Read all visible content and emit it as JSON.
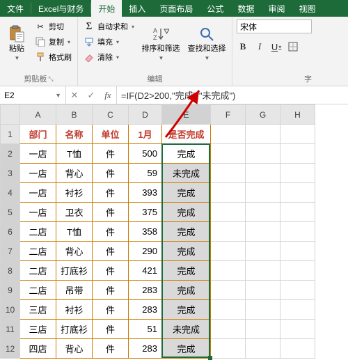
{
  "menu": {
    "file": "文件",
    "excel_finance": "Excel与财务",
    "start": "开始",
    "insert": "插入",
    "pagelayout": "页面布局",
    "formulas": "公式",
    "data": "数据",
    "review": "审阅",
    "view": "视图"
  },
  "ribbon": {
    "clipboard": {
      "label": "剪贴板",
      "paste": "粘贴",
      "cut": "剪切",
      "copy": "复制",
      "formatpainter": "格式刷"
    },
    "edit": {
      "label": "编辑",
      "autosum": "自动求和",
      "fill": "填充",
      "clear": "清除",
      "sortfilter": "排序和筛选",
      "findselect": "查找和选择"
    },
    "font": {
      "label_partial": "字",
      "family": "宋体"
    }
  },
  "formula_bar": {
    "cell_ref": "E2",
    "fx": "fx",
    "formula": "=IF(D2>200,\"完成\",\"未完成\")"
  },
  "chart_data": {
    "type": "table",
    "headers": {
      "dept": "部门",
      "name": "名称",
      "unit": "单位",
      "month": "1月",
      "status": "是否完成"
    },
    "rows": [
      {
        "dept": "一店",
        "name": "T恤",
        "unit": "件",
        "val": 500,
        "status": "完成"
      },
      {
        "dept": "一店",
        "name": "背心",
        "unit": "件",
        "val": 59,
        "status": "未完成"
      },
      {
        "dept": "一店",
        "name": "衬衫",
        "unit": "件",
        "val": 393,
        "status": "完成"
      },
      {
        "dept": "一店",
        "name": "卫衣",
        "unit": "件",
        "val": 375,
        "status": "完成"
      },
      {
        "dept": "二店",
        "name": "T恤",
        "unit": "件",
        "val": 358,
        "status": "完成"
      },
      {
        "dept": "二店",
        "name": "背心",
        "unit": "件",
        "val": 290,
        "status": "完成"
      },
      {
        "dept": "二店",
        "name": "打底衫",
        "unit": "件",
        "val": 421,
        "status": "完成"
      },
      {
        "dept": "二店",
        "name": "吊带",
        "unit": "件",
        "val": 283,
        "status": "完成"
      },
      {
        "dept": "三店",
        "name": "衬衫",
        "unit": "件",
        "val": 283,
        "status": "完成"
      },
      {
        "dept": "三店",
        "name": "打底衫",
        "unit": "件",
        "val": 51,
        "status": "未完成"
      },
      {
        "dept": "四店",
        "name": "背心",
        "unit": "件",
        "val": 283,
        "status": "完成"
      }
    ]
  },
  "cols": [
    "A",
    "B",
    "C",
    "D",
    "E",
    "F",
    "G",
    "H"
  ]
}
